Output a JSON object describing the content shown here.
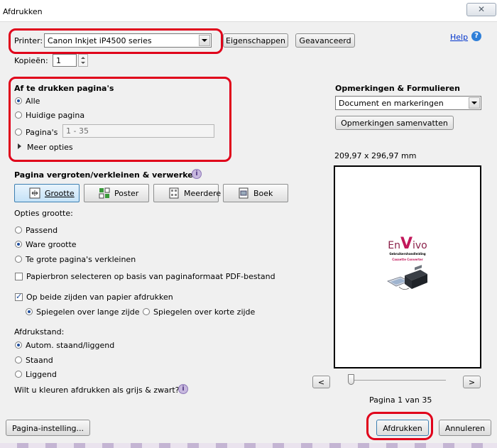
{
  "window": {
    "title": "Afdrukken",
    "close_glyph": "✕"
  },
  "printer": {
    "label": "Printer:",
    "selected": "Canon Inkjet iP4500 series",
    "properties_button": "Eigenschappen",
    "advanced_button": "Geavanceerd",
    "help_link": "Help",
    "help_icon_glyph": "?"
  },
  "copies": {
    "label": "Kopieën:",
    "value": "1"
  },
  "pages": {
    "heading": "Af te drukken pagina's",
    "options": [
      {
        "label": "Alle",
        "selected": true
      },
      {
        "label": "Huidige pagina",
        "selected": false
      },
      {
        "label": "Pagina's",
        "selected": false
      }
    ],
    "range_value": "1 - 35",
    "more_options": "Meer opties"
  },
  "sizing": {
    "heading": "Pagina vergroten/verkleinen & verwerken",
    "modes": [
      {
        "label": "Grootte",
        "selected": true,
        "icon": "size-icon"
      },
      {
        "label": "Poster",
        "selected": false,
        "icon": "poster-icon"
      },
      {
        "label": "Meerdere",
        "selected": false,
        "icon": "multiple-icon"
      },
      {
        "label": "Boek",
        "selected": false,
        "icon": "book-icon"
      }
    ],
    "size_options_label": "Opties grootte:",
    "size_options": [
      {
        "label": "Passend",
        "selected": false
      },
      {
        "label": "Ware grootte",
        "selected": true
      },
      {
        "label": "Te grote pagina's verkleinen",
        "selected": false
      }
    ],
    "paper_source_check": {
      "label": "Papierbron selecteren op basis van paginaformaat PDF-bestand",
      "checked": false
    },
    "duplex_check": {
      "label": "Op beide zijden van papier afdrukken",
      "checked": true
    },
    "duplex_options": [
      {
        "label": "Spiegelen over lange zijde",
        "selected": true
      },
      {
        "label": "Spiegelen over korte zijde",
        "selected": false
      }
    ]
  },
  "orientation": {
    "label": "Afdrukstand:",
    "options": [
      {
        "label": "Autom. staand/liggend",
        "selected": true
      },
      {
        "label": "Staand",
        "selected": false
      },
      {
        "label": "Liggend",
        "selected": false
      }
    ]
  },
  "grayscale_question": "Wilt u kleuren afdrukken als grijs & zwart?",
  "comments": {
    "heading": "Opmerkingen & Formulieren",
    "selected": "Document en markeringen",
    "summarize_button": "Opmerkingen samenvatten"
  },
  "preview": {
    "dimensions": "209,97 x 296,97 mm",
    "logo_left": "En",
    "logo_mid": "V",
    "logo_right": "ivo",
    "line1": "Gebruikershandleiding",
    "line2": "Cassette Converter",
    "page_status": "Pagina 1 van 35",
    "prev_glyph": "<",
    "next_glyph": ">",
    "slider_fraction": 0
  },
  "footer": {
    "page_setup_button": "Pagina-instelling...",
    "print_button": "Afdrukken",
    "cancel_button": "Annuleren"
  },
  "colors": {
    "highlight_red": "#e0001a",
    "link_blue": "#0033cc",
    "selected_tab": "#c5e2f7"
  }
}
